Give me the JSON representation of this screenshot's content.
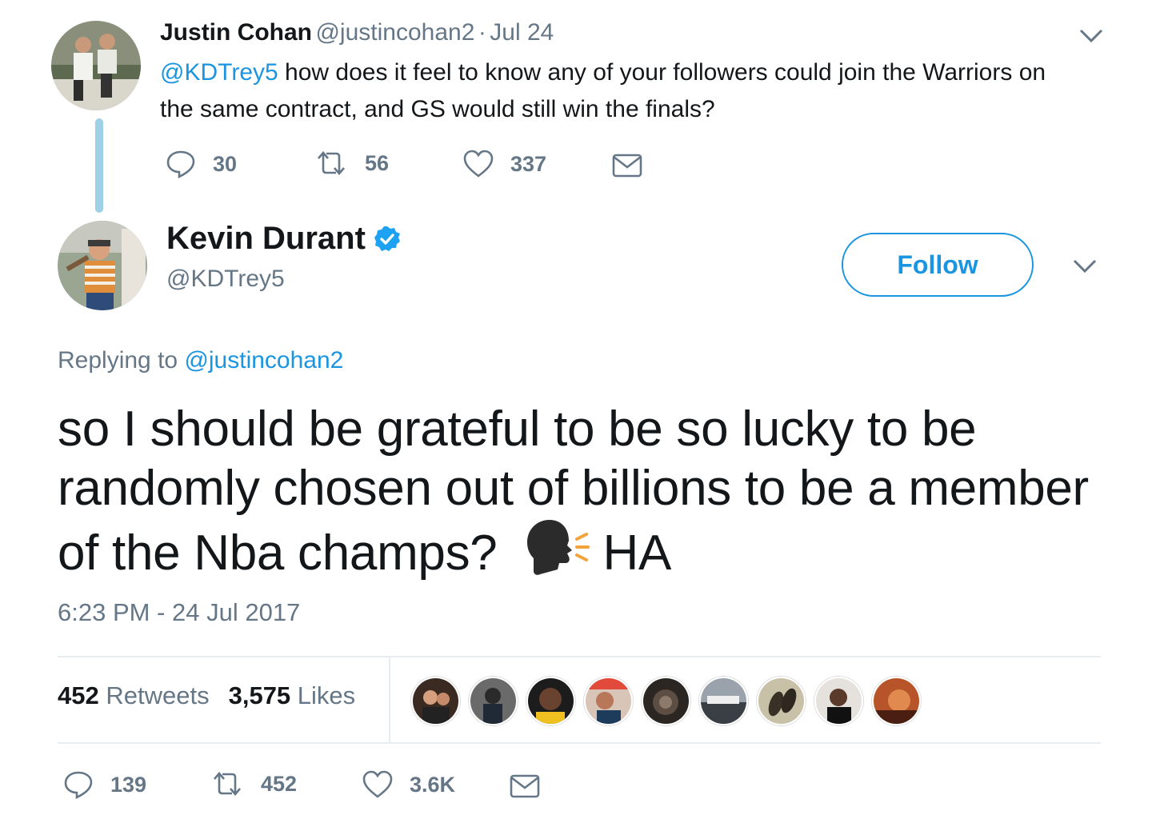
{
  "parent_tweet": {
    "author_name": "Justin Cohan",
    "author_handle": "@justincohan2",
    "separator": "·",
    "date": "Jul 24",
    "mention": "@KDTrey5",
    "text": " how does it feel to know any of your followers could join the Warriors on the same contract, and GS would still win the finals?",
    "replies": "30",
    "retweets": "56",
    "likes": "337"
  },
  "main_tweet": {
    "author_name": "Kevin Durant",
    "author_handle": "@KDTrey5",
    "verified": true,
    "follow_label": "Follow",
    "replying_prefix": "Replying to",
    "replying_to": "@justincohan2",
    "text_part1": "so I should be grateful to be so lucky to be randomly chosen out of billions to be a member of the Nba champs?",
    "emoji": "speaking-head-icon",
    "text_part2": "HA",
    "timestamp": "6:23 PM - 24 Jul 2017",
    "retweet_count": "452",
    "retweet_label": "Retweets",
    "like_count": "3,575",
    "like_label": "Likes",
    "actions": {
      "replies": "139",
      "retweets": "452",
      "likes": "3.6K"
    }
  },
  "colors": {
    "link": "#1b95e0",
    "secondary_text": "#657786",
    "thread_line": "#9ed0e6",
    "verified": "#1da1f2"
  }
}
